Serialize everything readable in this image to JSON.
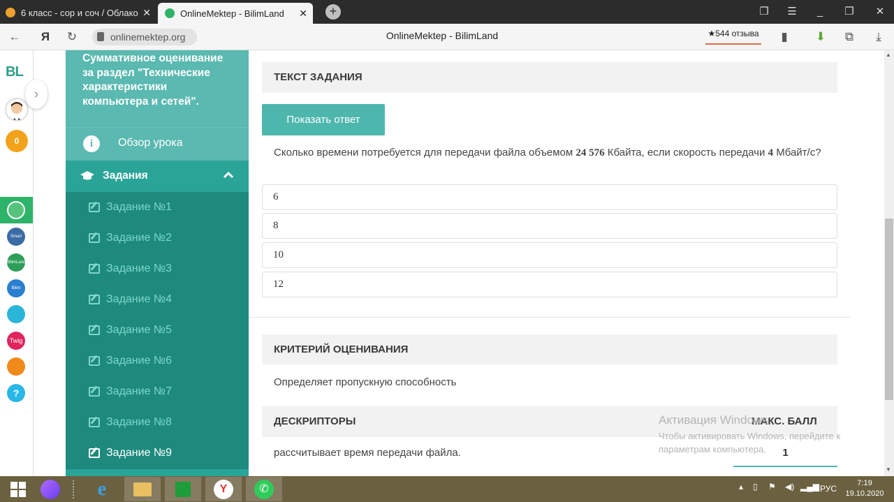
{
  "browser": {
    "tabs": [
      {
        "label": "6 класс - сор и соч / Облако"
      },
      {
        "label": "OnlineMektep - BilimLand"
      }
    ],
    "url": "onlinemektep.org",
    "page_title": "OnlineMektep - BilimLand",
    "reviews": "★544 отзыва"
  },
  "rail": {
    "logo": "BL",
    "coins": "0",
    "items": [
      {
        "name": "onlinemektep",
        "color": "#2eb36a"
      },
      {
        "name": "smart-nation",
        "color": "#3b6ba5",
        "text": "Smart Nation"
      },
      {
        "name": "bilimland",
        "color": "#2e9e58",
        "text": "BilimLand"
      },
      {
        "name": "bilimbook",
        "color": "#2a7fd0",
        "text": "Bilim Book"
      },
      {
        "name": "test",
        "color": "#2bb5d9"
      },
      {
        "name": "twig",
        "color": "#e0245e",
        "text": "Twig"
      },
      {
        "name": "imektep",
        "color": "#f08a1a"
      },
      {
        "name": "help",
        "color": "#29b6e8",
        "text": "?"
      }
    ]
  },
  "sidebar": {
    "title": "Суммативное оценивание за раздел \"Технические характеристики компьютера и сетей\".",
    "overview": "Обзор урока",
    "tasks_label": "Задания",
    "tasks": [
      "Задание №1",
      "Задание №2",
      "Задание №3",
      "Задание №4",
      "Задание №5",
      "Задание №6",
      "Задание №7",
      "Задание №8",
      "Задание №9"
    ],
    "active_task": "Задание №9"
  },
  "content": {
    "task_header": "ТЕКСТ ЗАДАНИЯ",
    "show_answer": "Показать ответ",
    "question_pre": "Сколько времени потребуется для передачи файла объемом ",
    "question_num1": "24 576",
    "question_mid": " Кбайта, если скорость передачи ",
    "question_num2": "4",
    "question_post": " Мбайт/с?",
    "options": [
      "6",
      "8",
      "10",
      "12"
    ],
    "criteria_header": "КРИТЕРИЙ ОЦЕНИВАНИЯ",
    "criteria_text": "Определяет пропускную способность",
    "descriptors_header": "ДЕСКРИПТОРЫ",
    "max_score_header": "МАКС. БАЛЛ",
    "descriptor_text": "рассчитывает время передачи файла.",
    "score_value": "1"
  },
  "watermark": {
    "title": "Активация Windows",
    "text": "Чтобы активировать Windows, перейдите к параметрам компьютера."
  },
  "taskbar": {
    "lang": "РУС",
    "time": "7:19",
    "date": "19.10.2020"
  }
}
